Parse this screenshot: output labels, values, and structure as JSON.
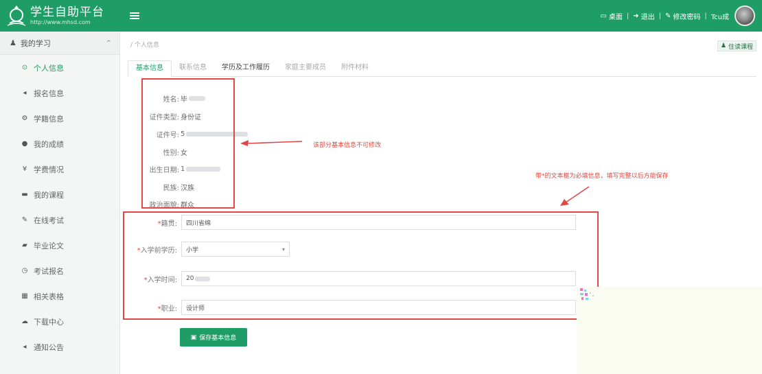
{
  "header": {
    "title": "学生自助平台",
    "url": "http://www.mhsd.com",
    "links": [
      {
        "icon": "monitor-icon",
        "label": "桌面"
      },
      {
        "icon": "logout-icon",
        "label": "退出"
      },
      {
        "icon": "key-icon",
        "label": "修改密码"
      },
      {
        "icon": "",
        "label": "Tcu成"
      }
    ],
    "separator": "|"
  },
  "sidebar": {
    "group": {
      "label": "我的学习",
      "arrow": "^"
    },
    "items": [
      {
        "icon": "user-circle-icon",
        "label": "个人信息",
        "active": true
      },
      {
        "icon": "megaphone-icon",
        "label": "报名信息"
      },
      {
        "icon": "gear-icon",
        "label": "学籍信息"
      },
      {
        "icon": "dot-icon",
        "label": "我的成绩"
      },
      {
        "icon": "yen-icon",
        "label": "学费情况"
      },
      {
        "icon": "book-icon",
        "label": "我的课程"
      },
      {
        "icon": "pencil-icon",
        "label": "在线考试"
      },
      {
        "icon": "graduation-icon",
        "label": "毕业论文"
      },
      {
        "icon": "clock-icon",
        "label": "考试报名"
      },
      {
        "icon": "grid-icon",
        "label": "相关表格"
      },
      {
        "icon": "cloud-icon",
        "label": "下载中心"
      },
      {
        "icon": "bell-icon",
        "label": "通知公告"
      }
    ]
  },
  "breadcrumb": "/ 个人信息",
  "top_button": "住读课程",
  "tabs": [
    {
      "label": "基本信息",
      "active": true
    },
    {
      "label": "联系信息"
    },
    {
      "label": "学历及工作履历",
      "dark": true
    },
    {
      "label": "家庭主要成员"
    },
    {
      "label": "附件材料"
    }
  ],
  "basic_info": [
    {
      "label": "姓名:",
      "value": "毕"
    },
    {
      "label": "证件类型:",
      "value": "身份证"
    },
    {
      "label": "证件号:",
      "value": "5"
    },
    {
      "label": "性别:",
      "value": "女"
    },
    {
      "label": "出生日期:",
      "value": "1"
    },
    {
      "label": "民族:",
      "value": "汉族"
    },
    {
      "label": "政治面貌:",
      "value": "群众"
    }
  ],
  "annotations": {
    "readonly_note": "该部分基本信息不可修改",
    "required_note": "带*的文本框为必填信息，填写完整以后方能保存"
  },
  "form": {
    "fields": [
      {
        "label": "籍贯:",
        "required": "*",
        "value": "四川省绵"
      },
      {
        "label": "入学前学历:",
        "required": "*",
        "value": "小学",
        "type": "select"
      },
      {
        "label": "入学时间:",
        "required": "*",
        "value": "20"
      },
      {
        "label": "职业:",
        "required": "*",
        "value": "设计师"
      }
    ],
    "save_label": "保存基本信息"
  }
}
